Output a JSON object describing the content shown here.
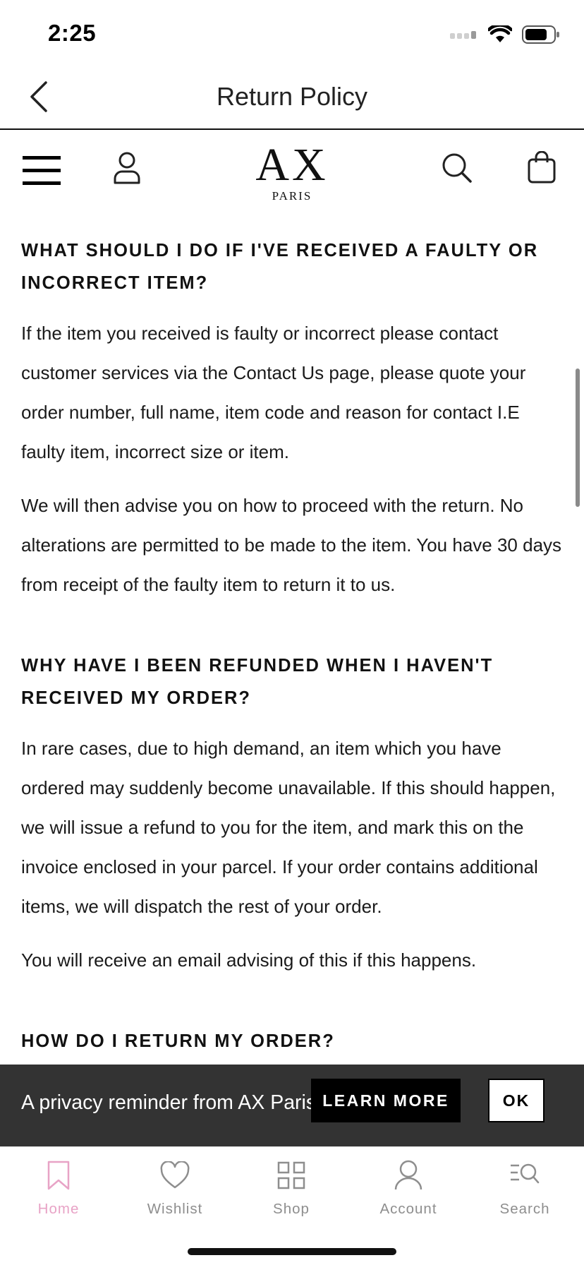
{
  "status_bar": {
    "time": "2:25"
  },
  "header": {
    "title": "Return Policy"
  },
  "brand": {
    "logo_main": "AX",
    "logo_sub": "PARIS"
  },
  "content": {
    "sections": [
      {
        "heading": "WHAT SHOULD I DO IF I'VE RECEIVED A FAULTY OR INCORRECT ITEM?",
        "paragraphs": [
          "If the item you received is faulty or incorrect please contact customer services via the Contact Us page, please quote your order number, full name, item code and reason for contact I.E faulty item, incorrect size or item.",
          "We will then advise you on how to proceed with the return. No alterations are permitted to be made to the item. You have 30 days from receipt of the faulty item to return it to us."
        ]
      },
      {
        "heading": "WHY HAVE I BEEN REFUNDED WHEN I HAVEN'T RECEIVED MY ORDER?",
        "paragraphs": [
          "In rare cases, due to high demand, an item which you have ordered may suddenly become unavailable. If this should happen, we will issue a refund to you for the item, and mark this on the invoice enclosed in your parcel. If your order contains additional items, we will dispatch the rest of your order.",
          "You will receive an email advising of this if this happens."
        ]
      },
      {
        "heading": "HOW DO I RETURN MY ORDER?"
      }
    ]
  },
  "privacy_banner": {
    "text": "A privacy reminder from AX Paris",
    "learn_more": "LEARN MORE",
    "ok": "OK"
  },
  "tab_bar": {
    "active_color": "#e8a3c6",
    "inactive_color": "#8e8e8e",
    "tabs": [
      {
        "label": "Home",
        "icon": "bookmark-icon",
        "active": true
      },
      {
        "label": "Wishlist",
        "icon": "heart-icon",
        "active": false
      },
      {
        "label": "Shop",
        "icon": "grid-icon",
        "active": false
      },
      {
        "label": "Account",
        "icon": "person-icon",
        "active": false
      },
      {
        "label": "Search",
        "icon": "search-list-icon",
        "active": false
      }
    ]
  }
}
